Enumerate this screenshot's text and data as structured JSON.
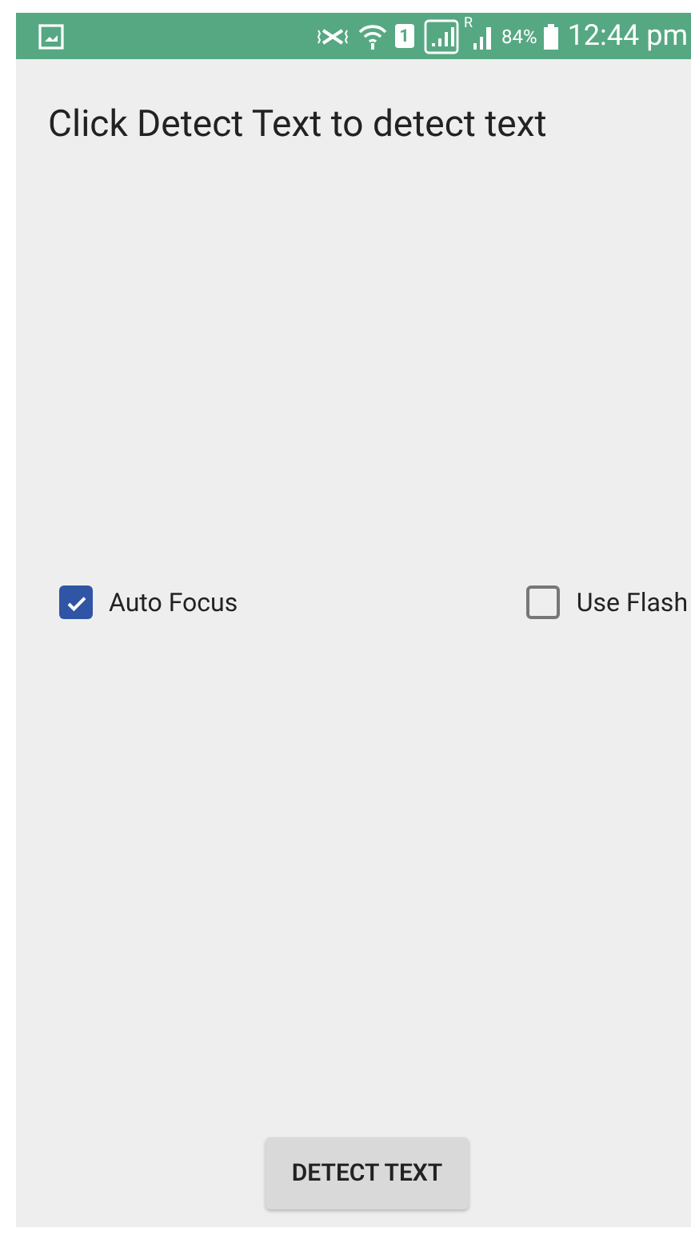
{
  "status_bar": {
    "battery": "84%",
    "time": "12:44 pm",
    "sim_slot": "1",
    "roaming": "R"
  },
  "title": "Click Detect Text to detect text",
  "options": [
    {
      "label": "Auto Focus",
      "checked": true
    },
    {
      "label": "Use Flash",
      "checked": false
    }
  ],
  "button": "DETECT TEXT"
}
